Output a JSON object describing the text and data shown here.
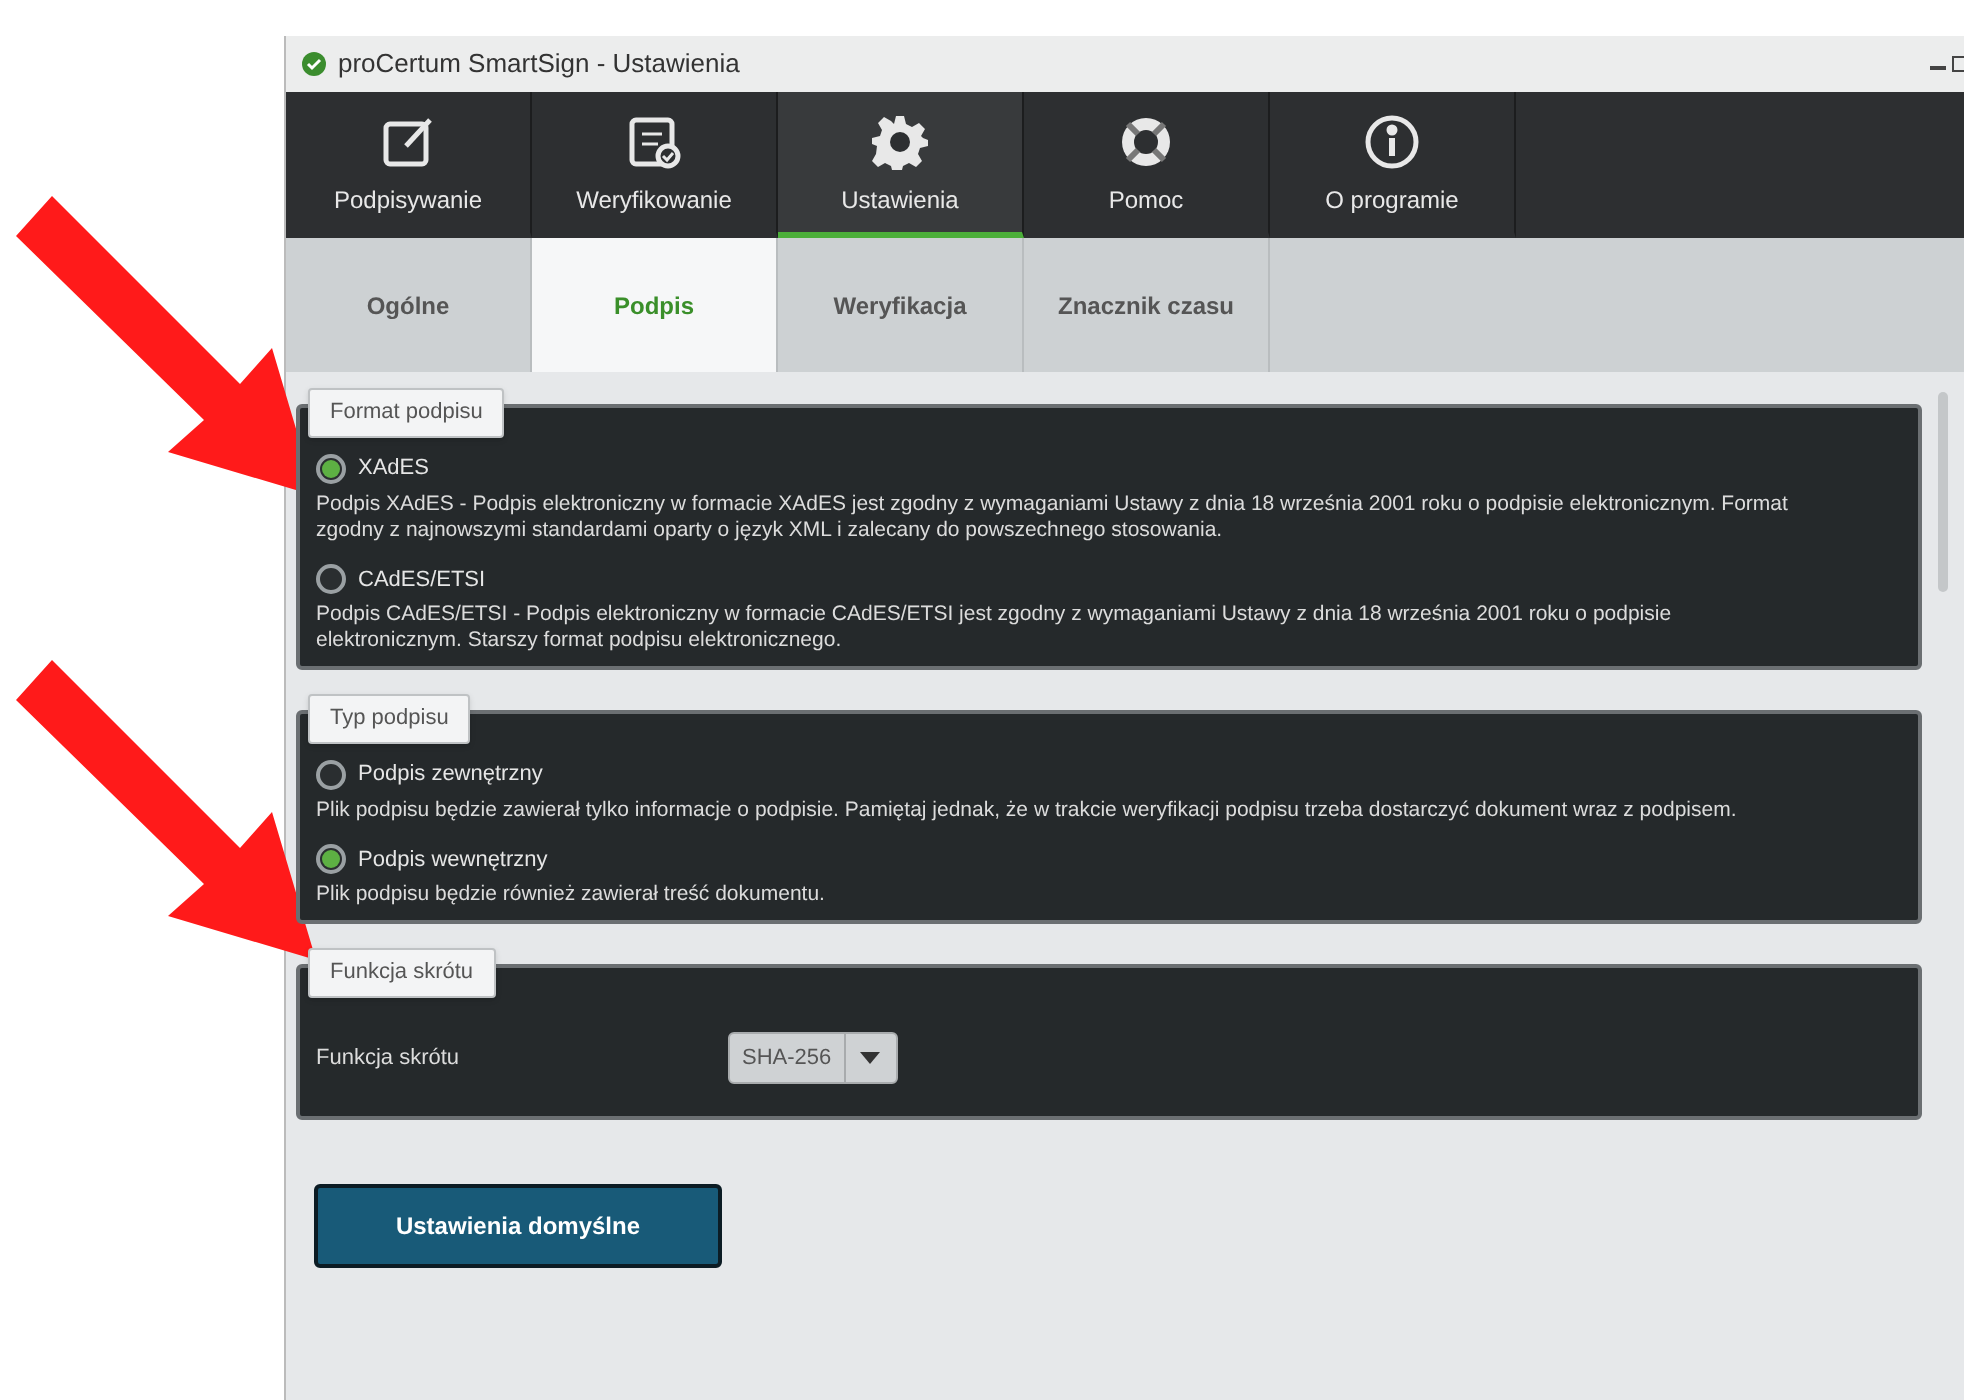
{
  "window": {
    "title": "proCertum SmartSign - Ustawienia"
  },
  "nav": [
    {
      "label": "Podpisywanie",
      "selected": false
    },
    {
      "label": "Weryfikowanie",
      "selected": false
    },
    {
      "label": "Ustawienia",
      "selected": true
    },
    {
      "label": "Pomoc",
      "selected": false
    },
    {
      "label": "O programie",
      "selected": false
    }
  ],
  "tabs": [
    {
      "label": "Ogólne",
      "selected": false
    },
    {
      "label": "Podpis",
      "selected": true
    },
    {
      "label": "Weryfikacja",
      "selected": false
    },
    {
      "label": "Znacznik czasu",
      "selected": false
    }
  ],
  "sections": [
    {
      "title": "Format podpisu",
      "kind": "radios",
      "options": [
        {
          "label": "XAdES",
          "selected": true,
          "description": "Podpis XAdES - Podpis elektroniczny w formacie XAdES jest zgodny z wymaganiami Ustawy z dnia 18 września 2001 roku o podpisie elektronicznym. Format zgodny z najnowszymi standardami oparty o język XML i zalecany do powszechnego stosowania."
        },
        {
          "label": "CAdES/ETSI",
          "selected": false,
          "description": "Podpis CAdES/ETSI - Podpis elektroniczny w formacie CAdES/ETSI jest zgodny z wymaganiami Ustawy z dnia 18 września 2001 roku o podpisie elektronicznym. Starszy format podpisu elektronicznego."
        }
      ]
    },
    {
      "title": "Typ podpisu",
      "kind": "radios",
      "options": [
        {
          "label": "Podpis zewnętrzny",
          "selected": false,
          "description": "Plik podpisu będzie zawierał tylko informacje o podpisie. Pamiętaj jednak, że w trakcie weryfikacji podpisu trzeba dostarczyć dokument wraz z podpisem."
        },
        {
          "label": "Podpis wewnętrzny",
          "selected": true,
          "description": "Plik podpisu będzie również zawierał treść dokumentu."
        }
      ]
    },
    {
      "title": "Funkcja skrótu",
      "kind": "select",
      "label": "Funkcja skrótu",
      "value": "SHA-256"
    }
  ],
  "default_button": "Ustawienia domyślne"
}
